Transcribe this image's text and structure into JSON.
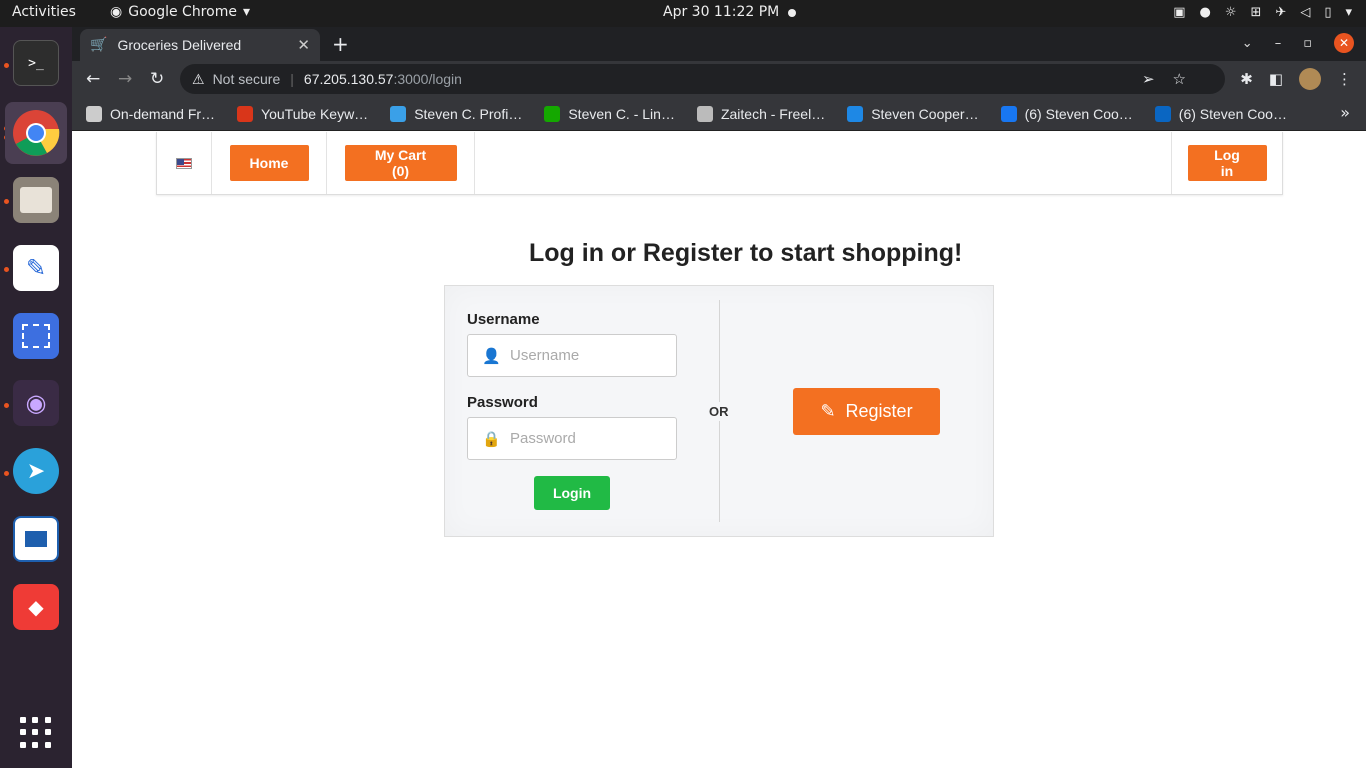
{
  "os": {
    "activities": "Activities",
    "app_name": "Google Chrome",
    "clock": "Apr 30  11:22 PM"
  },
  "browser": {
    "tab_title": "Groceries Delivered",
    "new_tab": "+",
    "not_secure": "Not secure",
    "url_host": "67.205.130.57",
    "url_path": ":3000/login",
    "bookmarks": [
      {
        "label": "On-demand Fr…",
        "color": "#cccccc"
      },
      {
        "label": "YouTube Keyw…",
        "color": "#d9361a"
      },
      {
        "label": "Steven C. Profi…",
        "color": "#3aa0e8"
      },
      {
        "label": "Steven C. - Lin…",
        "color": "#14a800"
      },
      {
        "label": "Zaitech - Freel…",
        "color": "#bbbbbb"
      },
      {
        "label": "Steven Cooper…",
        "color": "#1e88e5"
      },
      {
        "label": "(6) Steven Coo…",
        "color": "#1877f2"
      },
      {
        "label": "(6) Steven Coo…",
        "color": "#0a66c2"
      }
    ]
  },
  "site": {
    "nav": {
      "home": "Home",
      "cart": "My Cart (0)",
      "login": "Log in"
    },
    "heading": "Log in or Register to start shopping!",
    "form": {
      "username_label": "Username",
      "username_placeholder": "Username",
      "password_label": "Password",
      "password_placeholder": "Password",
      "login_button": "Login",
      "or": "OR",
      "register_button": "Register"
    },
    "colors": {
      "accent": "#f37021",
      "login_green": "#21ba45"
    }
  }
}
